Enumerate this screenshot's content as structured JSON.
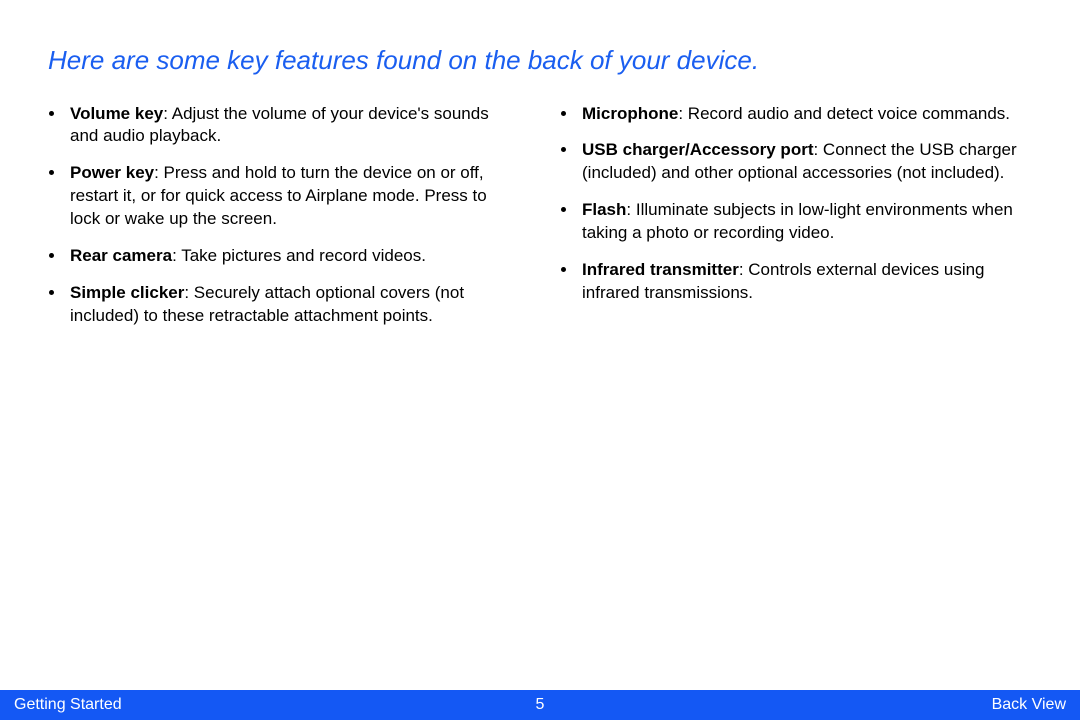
{
  "heading": "Here are some key features found on the back of your device.",
  "leftItems": [
    {
      "term": "Volume key",
      "desc": ": Adjust the volume of your device's sounds and audio playback."
    },
    {
      "term": "Power key",
      "desc": ": Press and hold to turn the device on or off, restart it, or for quick access to Airplane mode. Press to lock or wake up the screen."
    },
    {
      "term": "Rear camera",
      "desc": ": Take pictures and record videos."
    },
    {
      "term": "Simple clicker",
      "desc": ": Securely attach optional covers (not included) to these retractable attachment points."
    }
  ],
  "rightItems": [
    {
      "term": "Microphone",
      "desc": ": Record audio and detect voice commands."
    },
    {
      "term": "USB charger/Accessory port",
      "desc": ": Connect the USB charger (included) and other optional accessories (not included)."
    },
    {
      "term": "Flash",
      "desc": ": Illuminate subjects in low-light environments when taking a photo or recording video."
    },
    {
      "term": "Infrared transmitter",
      "desc": ": Controls external devices using infrared transmissions."
    }
  ],
  "footer": {
    "left": "Getting Started",
    "center": "5",
    "right": "Back View"
  }
}
